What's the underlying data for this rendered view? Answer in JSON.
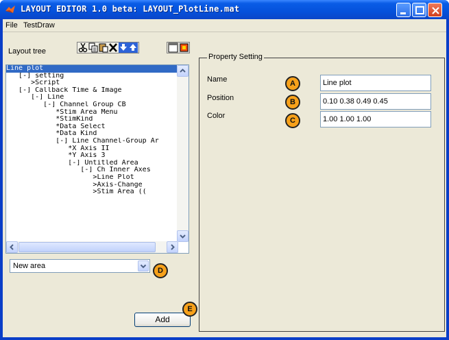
{
  "window": {
    "title": "LAYOUT EDITOR 1.0 beta: LAYOUT_PlotLine.mat"
  },
  "menu": {
    "items": [
      "File",
      "TestDraw"
    ]
  },
  "left": {
    "tree_label": "Layout tree",
    "tree_lines": [
      "Line plot",
      "   [-] setting",
      "      >Script",
      "   [-] Callback Time & Image",
      "      [-] Line",
      "         [-] Channel Group CB",
      "            *Stim Area Menu",
      "            *StimKind",
      "            *Data Select",
      "            *Data Kind",
      "            [-] Line Channel-Group Ar",
      "               *X Axis II",
      "               *Y Axis 3",
      "               [-] Untitled Area",
      "                  [-] Ch Inner Axes",
      "                     >Line Plot",
      "                     >Axis-Change",
      "                     >Stim Area (("
    ],
    "area_select": {
      "value": "New area"
    },
    "add_label": "Add"
  },
  "properties": {
    "group_title": "Property Setting",
    "rows": [
      {
        "label": "Name",
        "badge": "A",
        "value": "Line plot"
      },
      {
        "label": "Position",
        "badge": "B",
        "value": "0.10  0.38  0.49  0.45"
      },
      {
        "label": "Color",
        "badge": "C",
        "value": "1.00  1.00  1.00"
      }
    ]
  },
  "badges": {
    "select": "D",
    "add": "E"
  },
  "icons": [
    "matlab-icon",
    "cut-icon",
    "copy-icon",
    "paste-icon",
    "delete-icon",
    "move-down-icon",
    "move-up-icon",
    "new-figure-icon",
    "color-figure-icon"
  ],
  "colors": {
    "titlebar": "#0a5ce6",
    "selection": "#316ac5",
    "badge": "#f7a11a",
    "face": "#ece9d8"
  }
}
